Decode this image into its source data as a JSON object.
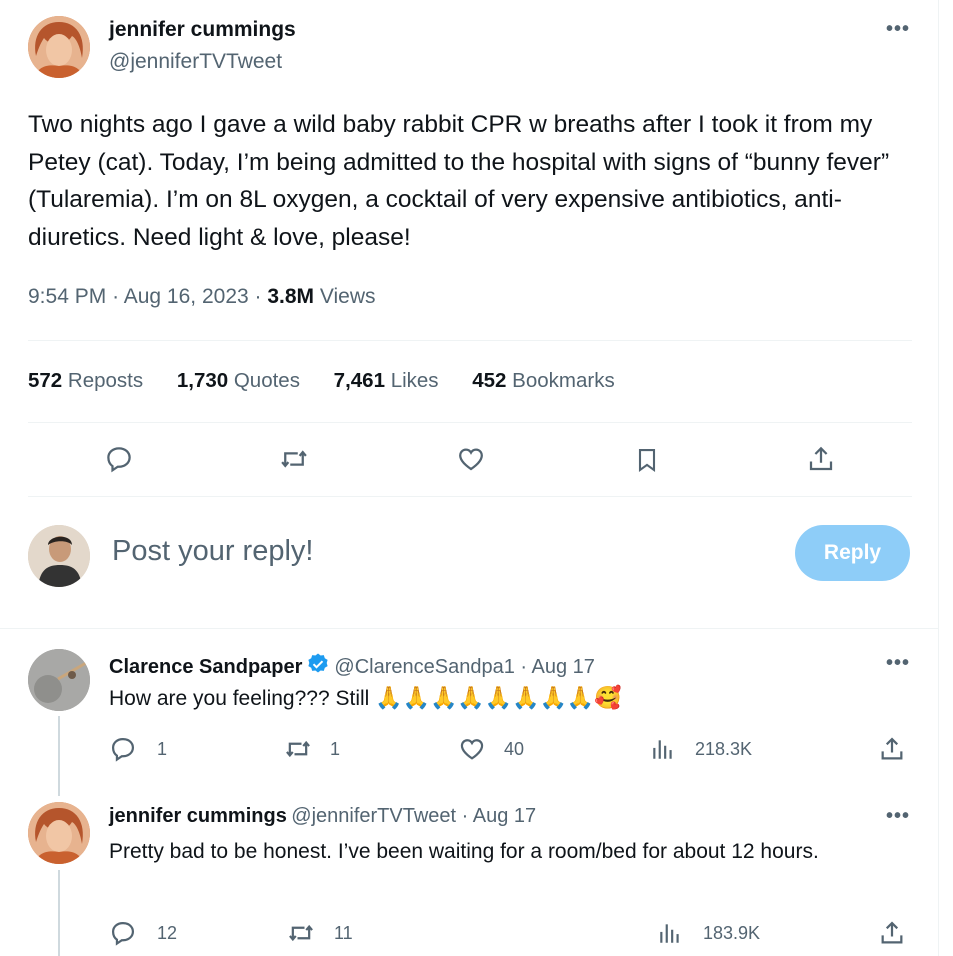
{
  "main_tweet": {
    "author_name": "jennifer cummings",
    "author_handle": "@jenniferTVTweet",
    "text": "Two nights ago I gave a wild baby rabbit CPR w breaths after I took it from my Petey (cat). Today, I’m being admitted to the hospital with signs of “bunny fever” (Tularemia). I’m on 8L oxygen, a cocktail of very expensive antibiotics, anti-diuretics. Need light & love, please!",
    "time": "9:54 PM",
    "date": "Aug 16, 2023",
    "views_count": "3.8M",
    "views_label": "Views",
    "stats": {
      "reposts_count": "572",
      "reposts_label": "Reposts",
      "quotes_count": "1,730",
      "quotes_label": "Quotes",
      "likes_count": "7,461",
      "likes_label": "Likes",
      "bookmarks_count": "452",
      "bookmarks_label": "Bookmarks"
    }
  },
  "composer": {
    "placeholder": "Post your reply!",
    "reply_button": "Reply"
  },
  "replies": [
    {
      "author_name": "Clarence Sandpaper",
      "author_handle": "@ClarenceSandpa1",
      "date": "Aug 17",
      "text": "How are you feeling??? Still",
      "emoji": "🙏🙏🙏🙏🙏🙏🙏🙏🥰",
      "reply_count": "1",
      "repost_count": "1",
      "like_count": "40",
      "view_count": "218.3K"
    },
    {
      "author_name": "jennifer cummings",
      "author_handle": "@jenniferTVTweet",
      "date": "Aug 17",
      "text": "Pretty bad to be honest. I’ve been waiting for a room/bed for about 12 hours.",
      "reply_count": "12",
      "repost_count": "11",
      "view_count": "183.9K"
    }
  ],
  "colors": {
    "text_primary": "#0f1419",
    "text_secondary": "#536471",
    "reply_button_bg": "#8ecdf8",
    "verified_blue": "#1d9bf0",
    "divider": "#eff3f4"
  },
  "icons": [
    "more-icon",
    "reply-icon",
    "repost-icon",
    "like-icon",
    "bookmark-icon",
    "share-icon",
    "views-icon",
    "verified-badge-icon"
  ]
}
